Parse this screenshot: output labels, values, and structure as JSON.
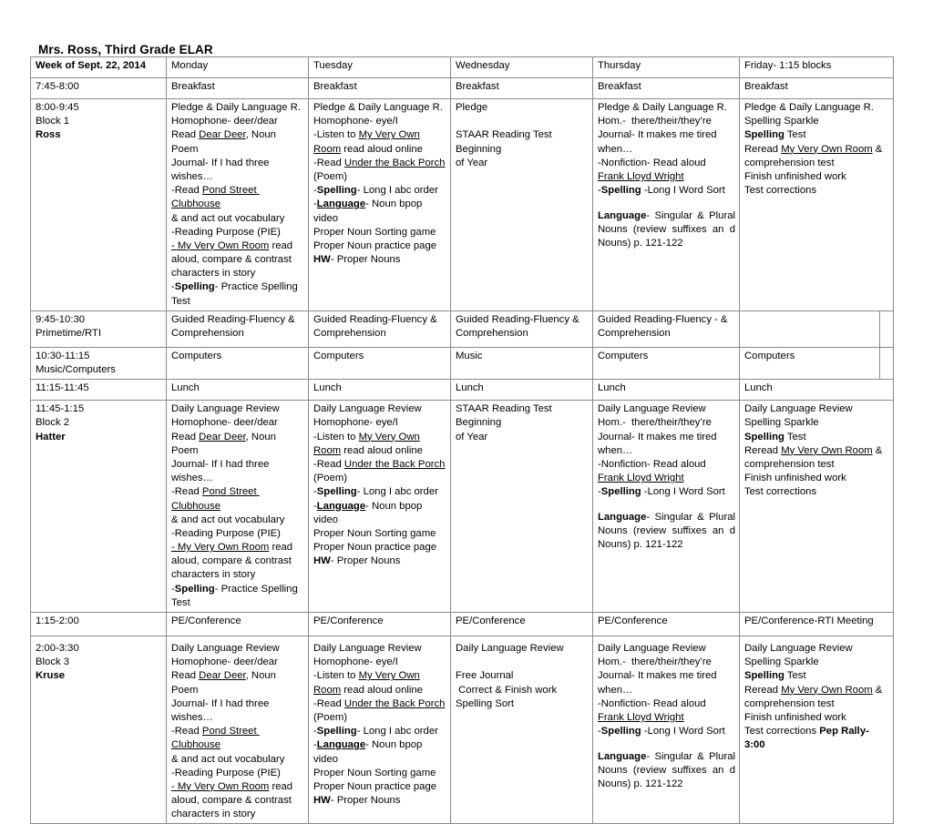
{
  "document": {
    "title": "Mrs. Ross, Third Grade ELAR"
  },
  "table": {
    "header": {
      "week_label": "Week of Sept.  22, 2014",
      "days": [
        "Monday",
        "Tuesday",
        "Wednesday",
        "Thursday",
        "Friday- 1:15 blocks"
      ]
    },
    "rows": {
      "breakfast": {
        "time": "7:45-8:00",
        "cells": [
          "Breakfast",
          "Breakfast",
          "Breakfast",
          "Breakfast",
          "Breakfast"
        ]
      },
      "block1": {
        "time": "8:00-9:45",
        "block": "Block 1",
        "teacher": "Ross",
        "monday": [
          "Pledge & Daily Language R.",
          "Homophone- deer/dear",
          "Read [u]Dear Deer[/u], Noun Poem",
          "Journal- If I had three",
          "wishes…",
          "-Read [u]Pond Street Clubhouse[/u]",
          "& and act out vocabulary",
          "-Reading Purpose (PIE)",
          "[u]- My Very Own Room[/u] read",
          "aloud, compare & contrast",
          "characters in story",
          "-[b]Spelling[/b]- Practice Spelling",
          "Test"
        ],
        "tuesday": [
          "Pledge & Daily Language R.",
          "Homophone- eye/I",
          "-Listen to [u]My Very Own[/u]",
          "[u]Room[/u] read aloud online",
          "-Read [u]Under the Back Porch[/u]",
          "(Poem)",
          "-[b]Spelling[/b]- Long I abc order",
          "-[b][u]Language[/u][/b]- Noun bpop video",
          "Proper Noun Sorting game",
          "Proper Noun practice page",
          "[b]HW[/b]- Proper Nouns"
        ],
        "wednesday": [
          "Pledge",
          "",
          "STAAR Reading Test  Beginning",
          "of Year"
        ],
        "thursday": [
          "Pledge & Daily Language R.",
          "Hom.-  there/their/they’re",
          "Journal- It makes me tired",
          "when…",
          "-Nonfiction- Read aloud",
          "[u]Frank Lloyd Wright[/u]",
          "-[b]Spelling[/b] -Long I Word Sort"
        ],
        "thursday_language": "[b]Language[/b]- Singular & Plural Nouns (review suffixes an d Nouns) p. 121-122",
        "friday": [
          "Pledge & Daily Language R.",
          "Spelling Sparkle",
          "[b]Spelling[/b] Test",
          "Reread [u]My Very Own Room[/u] &",
          "comprehension test",
          "Finish unfinished work",
          "Test corrections"
        ]
      },
      "guided_reading": {
        "time": "9:45-10:30",
        "subtitle": "Primetime/RTI",
        "cells": [
          "Guided Reading-Fluency & Comprehension",
          "Guided Reading-Fluency & Comprehension",
          "Guided Reading-Fluency & Comprehension",
          "Guided Reading-Fluency - & Comprehension",
          ""
        ]
      },
      "computers": {
        "time": "10:30-11:15",
        "subtitle": "Music/Computers",
        "cells": [
          "Computers",
          "Computers",
          "Music",
          "Computers",
          "Computers"
        ]
      },
      "lunch": {
        "time": "11:15-11:45",
        "cells": [
          "Lunch",
          "Lunch",
          "Lunch",
          "Lunch",
          "Lunch"
        ]
      },
      "block2": {
        "time": "11:45-1:15",
        "block": "Block 2",
        "teacher": "Hatter",
        "monday": [
          "Daily Language Review",
          "Homophone- deer/dear",
          "Read [u]Dear Deer[/u], Noun Poem",
          "Journal- If I had three",
          "wishes…",
          "-Read [u]Pond Street Clubhouse[/u]",
          "& and act out vocabulary",
          "-Reading Purpose (PIE)",
          "[u]- My Very Own Room[/u] read",
          "aloud, compare & contrast",
          "characters in story",
          "-[b]Spelling[/b]- Practice Spelling",
          "Test"
        ],
        "tuesday": [
          "Daily Language Review",
          "Homophone- eye/I",
          "-Listen to [u]My Very Own[/u]",
          "[u]Room[/u] read aloud online",
          "-Read [u]Under the Back Porch[/u]",
          "(Poem)",
          "-[b]Spelling[/b]- Long I abc order",
          "-[b][u]Language[/u][/b]- Noun bpop video",
          "Proper Noun Sorting game",
          "Proper Noun practice page",
          "[b]HW[/b]- Proper Nouns"
        ],
        "wednesday": [
          "STAAR Reading Test  Beginning",
          "of Year"
        ],
        "thursday": [
          "Daily Language Review",
          "Hom.-  there/their/they’re",
          "Journal- It makes me tired",
          "when…",
          "-Nonfiction- Read aloud",
          "[u]Frank Lloyd Wright[/u]",
          "-[b]Spelling[/b] -Long I Word Sort"
        ],
        "thursday_language": "[b]Language[/b]- Singular & Plural Nouns (review suffixes an d Nouns) p. 121-122",
        "friday": [
          "Daily Language Review",
          "Spelling Sparkle",
          "[b]Spelling[/b] Test",
          "Reread [u]My Very Own Room[/u] &",
          "comprehension test",
          "Finish unfinished work",
          "Test corrections"
        ]
      },
      "pe_conference": {
        "time": "1:15-2:00",
        "cells": [
          "PE/Conference",
          "PE/Conference",
          "PE/Conference",
          "PE/Conference",
          "PE/Conference-RTI Meeting"
        ]
      },
      "block3": {
        "time": "2:00-3:30",
        "block": "Block 3",
        "teacher": "Kruse",
        "monday": [
          "Daily Language Review",
          "Homophone- deer/dear",
          "Read [u]Dear Deer[/u], Noun Poem",
          "Journal- If I had three",
          "wishes…",
          "-Read [u]Pond Street Clubhouse[/u]",
          "& and act out vocabulary",
          "-Reading Purpose (PIE)",
          "[u]- My Very Own Room[/u] read",
          "aloud, compare & contrast",
          "characters in story"
        ],
        "tuesday": [
          "Daily Language Review",
          "Homophone- eye/I",
          "-Listen to [u]My Very Own[/u]",
          "[u]Room[/u] read aloud online",
          "-Read [u]Under the Back Porch[/u]",
          "(Poem)",
          "-[b]Spelling[/b]- Long I abc order",
          "-[b][u]Language[/u][/b]- Noun bpop video",
          "Proper Noun Sorting game",
          "Proper Noun practice page",
          "[b]HW[/b]- Proper Nouns"
        ],
        "wednesday": [
          "Daily Language Review",
          "",
          "Free Journal",
          " Correct & Finish work",
          "Spelling Sort"
        ],
        "thursday": [
          "Daily Language Review",
          "Hom.-  there/their/they’re",
          "Journal- It makes me tired",
          "when…",
          "-Nonfiction- Read aloud",
          "[u]Frank Lloyd Wright[/u]",
          "-[b]Spelling[/b] -Long I Word Sort"
        ],
        "thursday_language": "[b]Language[/b]- Singular & Plural Nouns (review suffixes an d Nouns) p. 121-122",
        "friday": [
          "Daily Language Review",
          "Spelling Sparkle",
          "[b]Spelling[/b] Test",
          "Reread [u]My Very Own Room[/u] &",
          "comprehension test",
          "Finish unfinished work",
          "Test corrections [b]Pep Rally- 3:00[/b]"
        ]
      }
    }
  }
}
